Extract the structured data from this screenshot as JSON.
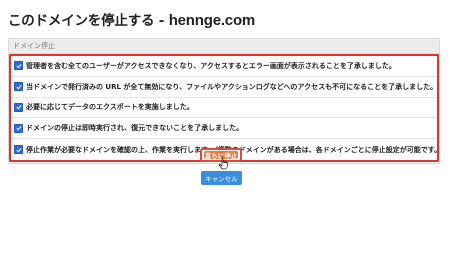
{
  "page": {
    "title_prefix": "このドメインを停止する - ",
    "title_domain": "hennge.com"
  },
  "panel": {
    "header": "ドメイン停止",
    "items": [
      {
        "label": "管理者を含む全てのユーザーがアクセスできなくなり、アクセスするとエラー画面が表示されることを了承しました。",
        "checked": true
      },
      {
        "label": "当ドメインで発行済みの URL が全て無効になり、ファイルやアクションログなどへのアクセスも不可になることを了承しました。",
        "checked": true
      },
      {
        "label": "必要に応じてデータのエクスポートを実施しました。",
        "checked": true
      },
      {
        "label": "ドメインの停止は即時実行され、復元できないことを了承しました。",
        "checked": true
      },
      {
        "label": "停止作業が必要なドメインを確認の上、作業を実行します。（複数のドメインがある場合は、各ドメインごとに停止設定が可能です。）",
        "checked": true
      }
    ]
  },
  "actions": {
    "stop_label": "直ちに停止",
    "cancel_label": "キャンセル"
  },
  "colors": {
    "highlight_border": "#d9362c",
    "stop_button": "#e5793a",
    "cancel_button": "#3b8de0",
    "checkbox": "#2f6fd6"
  },
  "icons": {
    "checkbox": "checkmark-icon",
    "cursor": "hand-pointer-icon"
  }
}
